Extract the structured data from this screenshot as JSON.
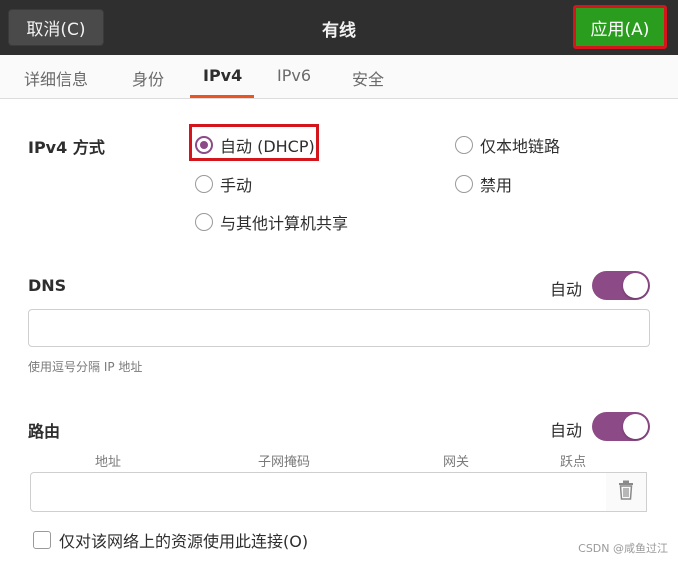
{
  "header": {
    "cancel_label": "取消(C)",
    "title": "有线",
    "apply_label": "应用(A)"
  },
  "tabs": [
    {
      "label": "详细信息",
      "active": false
    },
    {
      "label": "身份",
      "active": false
    },
    {
      "label": "IPv4",
      "active": true
    },
    {
      "label": "IPv6",
      "active": false
    },
    {
      "label": "安全",
      "active": false
    }
  ],
  "ipv4": {
    "method_label": "IPv4 方式",
    "options": [
      {
        "label": "自动 (DHCP)",
        "checked": true
      },
      {
        "label": "手动",
        "checked": false
      },
      {
        "label": "与其他计算机共享",
        "checked": false
      },
      {
        "label": "仅本地链路",
        "checked": false
      },
      {
        "label": "禁用",
        "checked": false
      }
    ]
  },
  "dns": {
    "label": "DNS",
    "auto_label": "自动",
    "auto_on": true,
    "value": "",
    "hint": "使用逗号分隔 IP 地址"
  },
  "routes": {
    "label": "路由",
    "auto_label": "自动",
    "auto_on": true,
    "columns": [
      "地址",
      "子网掩码",
      "网关",
      "跃点"
    ]
  },
  "footer": {
    "checkbox_label": "仅对该网络上的资源使用此连接(O)",
    "checkbox_checked": false
  },
  "watermark": "CSDN @咸鱼过江",
  "colors": {
    "accent": "#8c4a86",
    "tab_indicator": "#e95420",
    "apply_button": "#2a9d1f",
    "highlight": "#d4161c"
  }
}
